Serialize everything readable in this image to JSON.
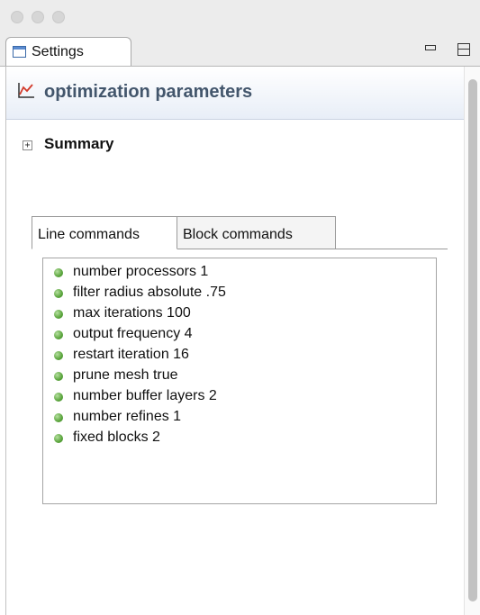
{
  "view_tab": {
    "label": "Settings"
  },
  "form": {
    "title": "optimization parameters"
  },
  "summary": {
    "label": "Summary",
    "toggle": "+"
  },
  "tabs": [
    {
      "label": "Line commands"
    },
    {
      "label": "Block commands"
    }
  ],
  "commands": [
    {
      "text": "number processors 1"
    },
    {
      "text": "filter radius absolute .75"
    },
    {
      "text": "max iterations 100"
    },
    {
      "text": "output frequency 4"
    },
    {
      "text": "restart iteration 16"
    },
    {
      "text": "prune mesh true"
    },
    {
      "text": "number buffer layers 2"
    },
    {
      "text": "number refines 1"
    },
    {
      "text": "fixed blocks 2"
    }
  ],
  "colors": {
    "title_text": "#43566c",
    "bullet": "#5aa43c"
  },
  "icons": {
    "view_tab": "view-window-icon",
    "form": "graph-chart-icon",
    "bullet": "green-dot-icon"
  }
}
